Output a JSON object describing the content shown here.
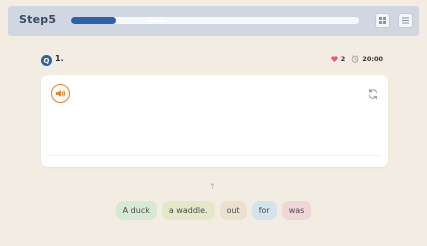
{
  "app": {
    "brand": "Step5"
  },
  "progress": {
    "fraction": 0.155,
    "color": "#2f5fa8"
  },
  "question": {
    "number_badge": "Q",
    "number_label": "1."
  },
  "stats": {
    "hearts": "2",
    "timer": "20:00"
  },
  "colors": {
    "accent_orange": "#ef7d1a",
    "heart": "#e85a6b",
    "chip_green": "#d7e8d4",
    "chip_olive": "#e4e8c9",
    "chip_tan": "#ece0cf",
    "chip_blue": "#d4e4ec",
    "chip_pink": "#efd6d8"
  },
  "words": [
    {
      "label": "A duck",
      "color": "#d7e8d4"
    },
    {
      "label": "a waddle.",
      "color": "#e4e8c9"
    },
    {
      "label": "out",
      "color": "#ece0cf"
    },
    {
      "label": "for",
      "color": "#d4e4ec"
    },
    {
      "label": "was",
      "color": "#efd6d8"
    }
  ],
  "icons": [
    "grid-icon",
    "list-icon",
    "heart-icon",
    "timer-icon",
    "speaker-icon",
    "refresh-icon",
    "up-arrow-icon"
  ]
}
